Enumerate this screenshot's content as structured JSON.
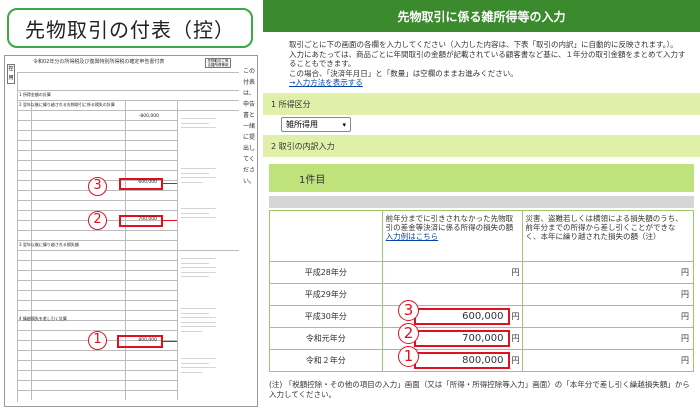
{
  "left": {
    "title": "先物取引の付表（控）",
    "form_header": "令和02年分の所得税及び復興特別所得税の確定申告書付表",
    "form_header_box": "先物取引に係る雑所得等用",
    "side_label": "控用",
    "side_column": "この付表は、申告書と一緒に提出してください。",
    "section1": "1 所得金額の計算",
    "section2": "2 翌年以後に繰り越される先物取引に係る損失の計算",
    "section3": "3 翌年以後に繰り越される損失額",
    "section4": "4 繰越損失を差し引く計算",
    "val_top": "-800,000",
    "val_a": "600,000",
    "val_b": "700,000",
    "val_c": "800,000",
    "callouts": [
      "3",
      "2",
      "1"
    ]
  },
  "right": {
    "header_title": "先物取引に係る雑所得等の入力",
    "intro_lines": [
      "取引ごとに下の画面の各欄を入力してください（入力した内容は、下表「取引の内訳」に自動的に反映されます。）。",
      "入力にあたっては、商品ごとに年間取引の金額が記載されている顧客書など基に、１年分の取引金額をまとめて入力することもできます。",
      "この場合、「決済年月日」と「数量」は空欄のままお進みください。"
    ],
    "intro_link": "→入力方法を表示する",
    "section1_label": "1  所得区分",
    "select_value": "雑所得用",
    "section2_label": "2  取引の内訳入力",
    "banner": "1件目",
    "col_mid_header": "前年分までに引きされなかった先物取引の差金等決済に係る所得の損失の額",
    "col_mid_link": "入力例はこちら",
    "col_right_header": "災害、盗難若しくは横領による損失額のうち、前年分までの所得から差し引くことができなく、本年に繰り越された損失の額（注）",
    "rows": [
      {
        "year": "平成28年分",
        "amount": "",
        "unit": "円",
        "right_unit": "円"
      },
      {
        "year": "平成29年分",
        "amount": "",
        "unit": "",
        "right_unit": "円"
      },
      {
        "year": "平成30年分",
        "amount": "600,000",
        "unit": "円",
        "right_unit": "円",
        "callout": "3"
      },
      {
        "year": "令和元年分",
        "amount": "700,000",
        "unit": "円",
        "right_unit": "円",
        "callout": "2"
      },
      {
        "year": "令和２年分",
        "amount": "800,000",
        "unit": "円",
        "right_unit": "円",
        "callout": "1"
      }
    ],
    "note_label": "(注)",
    "note_text": "「税額控除・その他の項目の入力」画面（又は「所得・所得控除等入力」画面）の「本年分で差し引く繰越損失額」から入力してください。"
  }
}
